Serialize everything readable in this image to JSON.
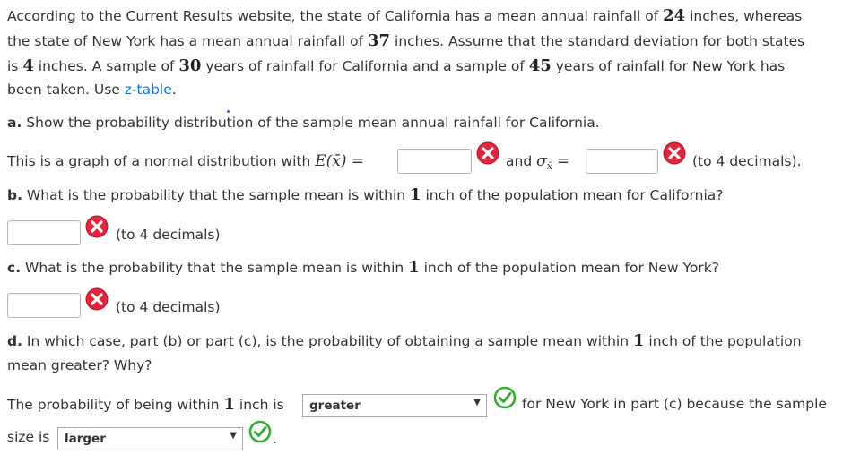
{
  "intro": {
    "l1a": "According to the Current Results website, the state of California has a mean annual rainfall of ",
    "ca_mean": "24",
    "l1b": " inches, whereas",
    "l2a": "the state of New York has a mean annual rainfall of ",
    "ny_mean": "37",
    "l2b": " inches. Assume that the standard deviation for both states",
    "l3a": "is ",
    "sd": "4",
    "l3b": " inches. A sample of ",
    "ca_n": "30",
    "l3c": " years of rainfall for California and a sample of ",
    "ny_n": "45",
    "l3d": " years of rainfall for New York has",
    "l4a": "been taken. Use ",
    "ztable": "z-table",
    "l4b": "."
  },
  "partA": {
    "q_prefix": "a.",
    "q_text": " Show the probability distribution of the sample mean annual rainfall for California.",
    "graph_text": "This is a graph of a normal distribution with ",
    "expect": "E(x̄) =",
    "and": "and",
    "sigma": "σ",
    "sigma_sub": "x̄",
    "eq": "=",
    "hint": "(to 4 decimals).",
    "expect_value": "",
    "sigma_value": ""
  },
  "partB": {
    "q_prefix": "b.",
    "q_text_a": " What is the probability that the sample mean is within ",
    "num": "1",
    "q_text_b": " inch of the population mean for California?",
    "hint": "(to 4 decimals)",
    "answer": ""
  },
  "partC": {
    "q_prefix": "c.",
    "q_text_a": " What is the probability that the sample mean is within ",
    "num": "1",
    "q_text_b": " inch of the population mean for New York?",
    "hint": "(to 4 decimals)",
    "answer": ""
  },
  "partD": {
    "q_prefix": "d.",
    "q_text_a": " In which case, part (b) or part (c), is the probability of obtaining a sample mean within ",
    "num": "1",
    "q_text_b": " inch of the population",
    "q_text_c": "mean greater? Why?",
    "ans_a": "The probability of being within ",
    "ans_num": "1",
    "ans_b": " inch is ",
    "select1_value": "greater",
    "ans_c": "for New York in part (c) because the sample",
    "ans_d": "size is ",
    "select2_value": "larger",
    "period": "."
  },
  "colors": {
    "wrong": "#e0263c",
    "correct": "#3aa935",
    "link": "#1a73c8"
  }
}
